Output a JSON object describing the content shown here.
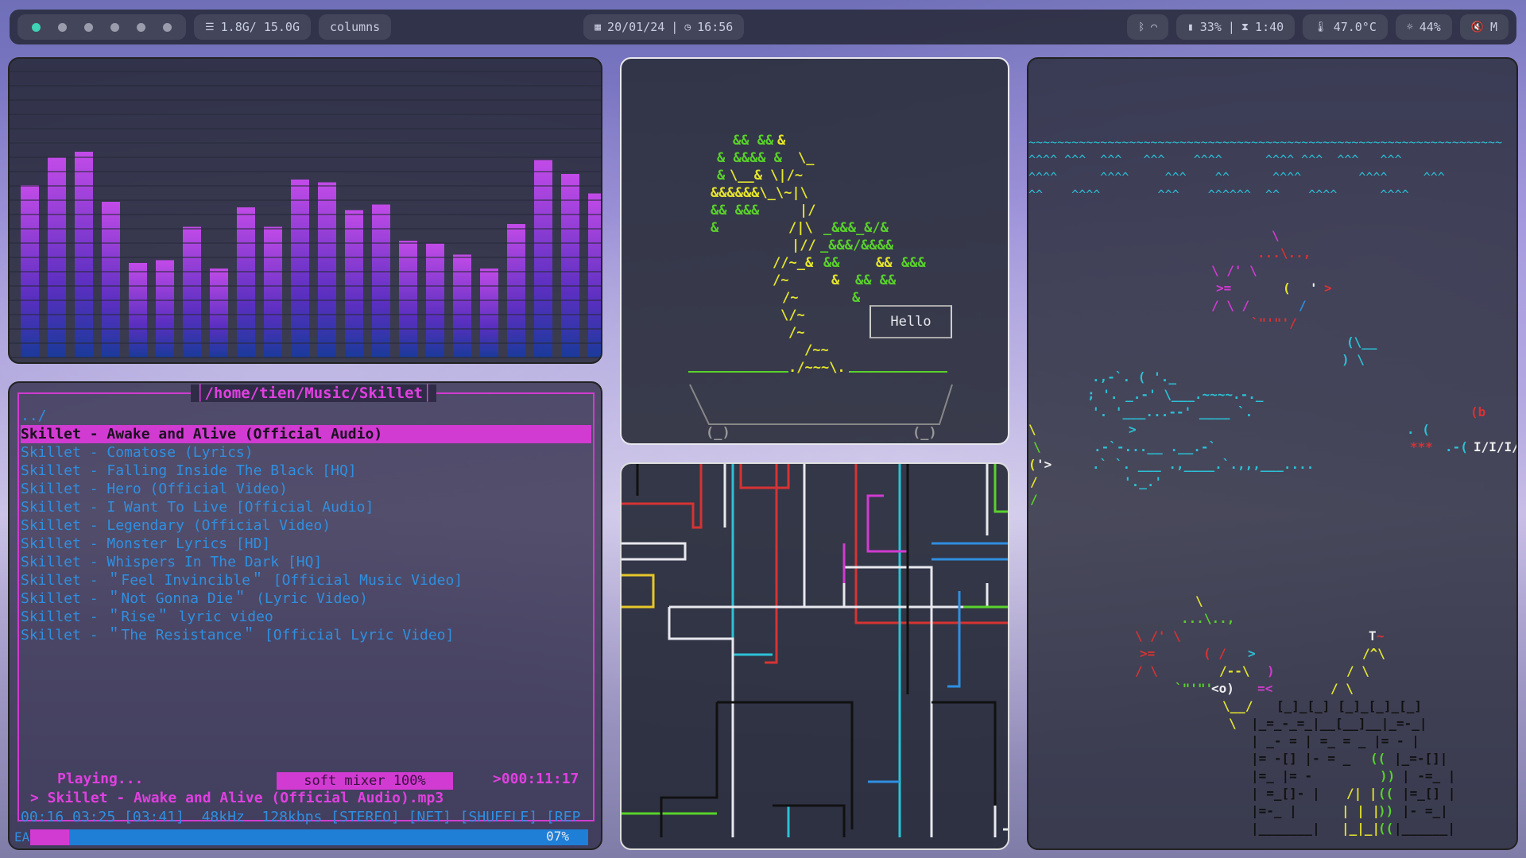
{
  "bar": {
    "workspaces": [
      true,
      false,
      false,
      false,
      false,
      false
    ],
    "memory": "1.8G/ 15.0G",
    "layout": "columns",
    "date": "20/01/24",
    "separator": "|",
    "time": "16:56",
    "battery": "33%",
    "battery_time": "1:40",
    "temperature": "47.0°C",
    "brightness": "44%",
    "volume": "M"
  },
  "visualizer": {
    "values": [
      0.62,
      0.72,
      0.74,
      0.56,
      0.34,
      0.35,
      0.47,
      0.32,
      0.54,
      0.47,
      0.64,
      0.63,
      0.53,
      0.55,
      0.42,
      0.41,
      0.37,
      0.32,
      0.48,
      0.71,
      0.66,
      0.59
    ]
  },
  "music": {
    "path": "/home/tien/Music/Skillet",
    "up": "../",
    "tracks": [
      "Skillet - Awake and Alive (Official Audio)",
      "Skillet - Comatose (Lyrics)",
      "Skillet - Falling Inside The Black [HQ]",
      "Skillet - Hero (Official Video)",
      "Skillet - I Want To Live [Official Audio]",
      "Skillet - Legendary (Official Video)",
      "Skillet - Monster Lyrics [HD]",
      "Skillet - Whispers In The Dark [HQ]",
      "Skillet - ＂Feel Invincible＂ [Official Music Video]",
      "Skillet - ＂Not Gonna Die＂ (Lyric Video)",
      "Skillet - ＂Rise＂ lyric video",
      "Skillet - ＂The Resistance＂ [Official Lyric Video]"
    ],
    "status": "Playing...",
    "mixer": "soft mixer 100%",
    "elapsed_total": ">000:11:17",
    "now_playing": "> Skillet - Awake and Alive (Official Audio).mp3",
    "info": "00:16 03:25 [03:41]  48kHz  128kbps [STEREO] [NET] [SHUFFLE] [REP",
    "progress": 0.07,
    "progress_label": "07%",
    "ea": "EA"
  },
  "bonsai": {
    "message": "Hello"
  },
  "colors": {
    "accent": "#d13bd1",
    "blue": "#2f8fe0",
    "teal": "#3fd2b6"
  }
}
